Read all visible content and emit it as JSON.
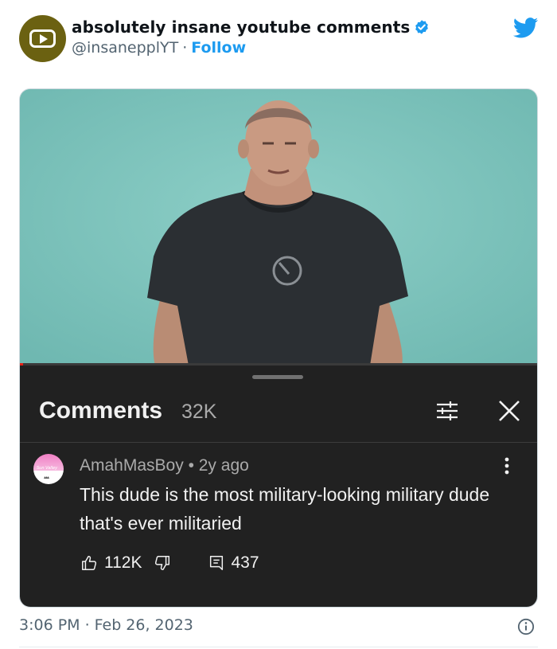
{
  "tweet": {
    "display_name": "absolutely insane youtube comments",
    "handle": "@insanepplYT",
    "separator": "·",
    "follow_label": "Follow",
    "time": "3:06 PM",
    "date": "Feb 26, 2023",
    "brand_color": "#1d9bf0"
  },
  "youtube_panel": {
    "title": "Comments",
    "count": "32K",
    "comment": {
      "author": "AmahMasBoy",
      "age": "• 2y ago",
      "avatar_text": "Sun Valley",
      "text": "This dude is the most military-looking military dude that's ever militaried",
      "likes": "112K",
      "replies": "437"
    }
  }
}
